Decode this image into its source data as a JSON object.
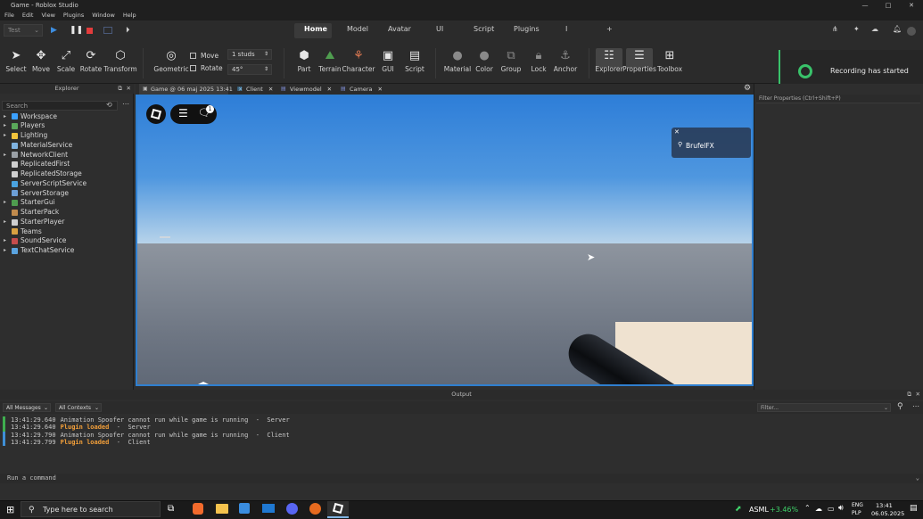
{
  "window": {
    "title": "Game - Roblox Studio",
    "controls": [
      "—",
      "□",
      "✕"
    ]
  },
  "menu": [
    "File",
    "Edit",
    "View",
    "Plugins",
    "Window",
    "Help"
  ],
  "top_tabs": [
    {
      "label": "Home"
    },
    {
      "label": "Model"
    },
    {
      "label": "Avatar"
    },
    {
      "label": "UI"
    },
    {
      "label": "Script"
    },
    {
      "label": "Plugins"
    },
    {
      "label": "I"
    }
  ],
  "play_control": {
    "mode_label": "Test"
  },
  "ribbon": {
    "tools": [
      "Select",
      "Move",
      "Scale",
      "Rotate",
      "Transform"
    ],
    "geometric_label": "Geometric",
    "move_label": "Move",
    "rotate_label": "Rotate",
    "studs_value": "1 studs",
    "angle_value": "45°",
    "insert": [
      "Part",
      "Terrain",
      "Character",
      "GUI",
      "Script"
    ],
    "edit": [
      "Material",
      "Color",
      "Group",
      "Lock",
      "Anchor"
    ],
    "view": [
      "Explorer",
      "Properties",
      "Toolbox"
    ]
  },
  "explorer": {
    "title": "Explorer",
    "search_placeholder": "Search",
    "items": [
      {
        "label": "Workspace",
        "color": "#3ba0ff",
        "arrow": true
      },
      {
        "label": "Players",
        "color": "#5aa85a",
        "arrow": true
      },
      {
        "label": "Lighting",
        "color": "#f2c43c",
        "arrow": true
      },
      {
        "label": "MaterialService",
        "color": "#7fb3e0",
        "arrow": false
      },
      {
        "label": "NetworkClient",
        "color": "#9aa0a6",
        "arrow": true
      },
      {
        "label": "ReplicatedFirst",
        "color": "#cfcfcf",
        "arrow": false
      },
      {
        "label": "ReplicatedStorage",
        "color": "#cfcfcf",
        "arrow": false
      },
      {
        "label": "ServerScriptService",
        "color": "#4aa3df",
        "arrow": false
      },
      {
        "label": "ServerStorage",
        "color": "#6c9fd6",
        "arrow": false
      },
      {
        "label": "StarterGui",
        "color": "#4f9d4f",
        "arrow": true
      },
      {
        "label": "StarterPack",
        "color": "#c18b4d",
        "arrow": false
      },
      {
        "label": "StarterPlayer",
        "color": "#cfcfcf",
        "arrow": true
      },
      {
        "label": "Teams",
        "color": "#d9a141",
        "arrow": false
      },
      {
        "label": "SoundService",
        "color": "#c44c4c",
        "arrow": true
      },
      {
        "label": "TextChatService",
        "color": "#5aa3df",
        "arrow": true
      }
    ]
  },
  "doc_tabs": [
    "Game @ 06 maj 2025 13:41",
    "Client",
    "Viewmodel",
    "Camera"
  ],
  "viewport": {
    "chat_badge": "1",
    "player_name": "BrufelFX"
  },
  "properties": {
    "filter_placeholder": "Filter Properties (Ctrl+Shift+P)"
  },
  "recording_toast": {
    "text": "Recording has started"
  },
  "output": {
    "title": "Output",
    "filter_messages": "All Messages",
    "filter_contexts": "All Contexts",
    "filter_placeholder": "Filter...",
    "lines": [
      {
        "time": "13:41:29.640",
        "message": "Animation Spoofer cannot run while game is running",
        "context": "Server",
        "highlight": false,
        "bar": "#3fae4f"
      },
      {
        "time": "13:41:29.640",
        "message": "Plugin loaded",
        "context": "Server",
        "highlight": true,
        "bar": "#3fae4f"
      },
      {
        "time": "13:41:29.790",
        "message": "Animation Spoofer cannot run while game is running",
        "context": "Client",
        "highlight": false,
        "bar": "#3f8fd6"
      },
      {
        "time": "13:41:29.799",
        "message": "Plugin loaded",
        "context": "Client",
        "highlight": true,
        "bar": "#3f8fd6"
      }
    ],
    "separator": "  -  ",
    "command_placeholder": "Run a command"
  },
  "taskbar": {
    "search_placeholder": "Type here to search",
    "stock_name": "ASML",
    "stock_change": "+3.46%",
    "lang_top": "ENG",
    "lang_bottom": "PLP",
    "time": "13:41",
    "date": "06.05.2025"
  },
  "colors": {
    "accent": "#2f7fd0",
    "recording": "#39c26a",
    "log_highlight": "#f29f3a",
    "stock_up": "#3fd26a"
  }
}
